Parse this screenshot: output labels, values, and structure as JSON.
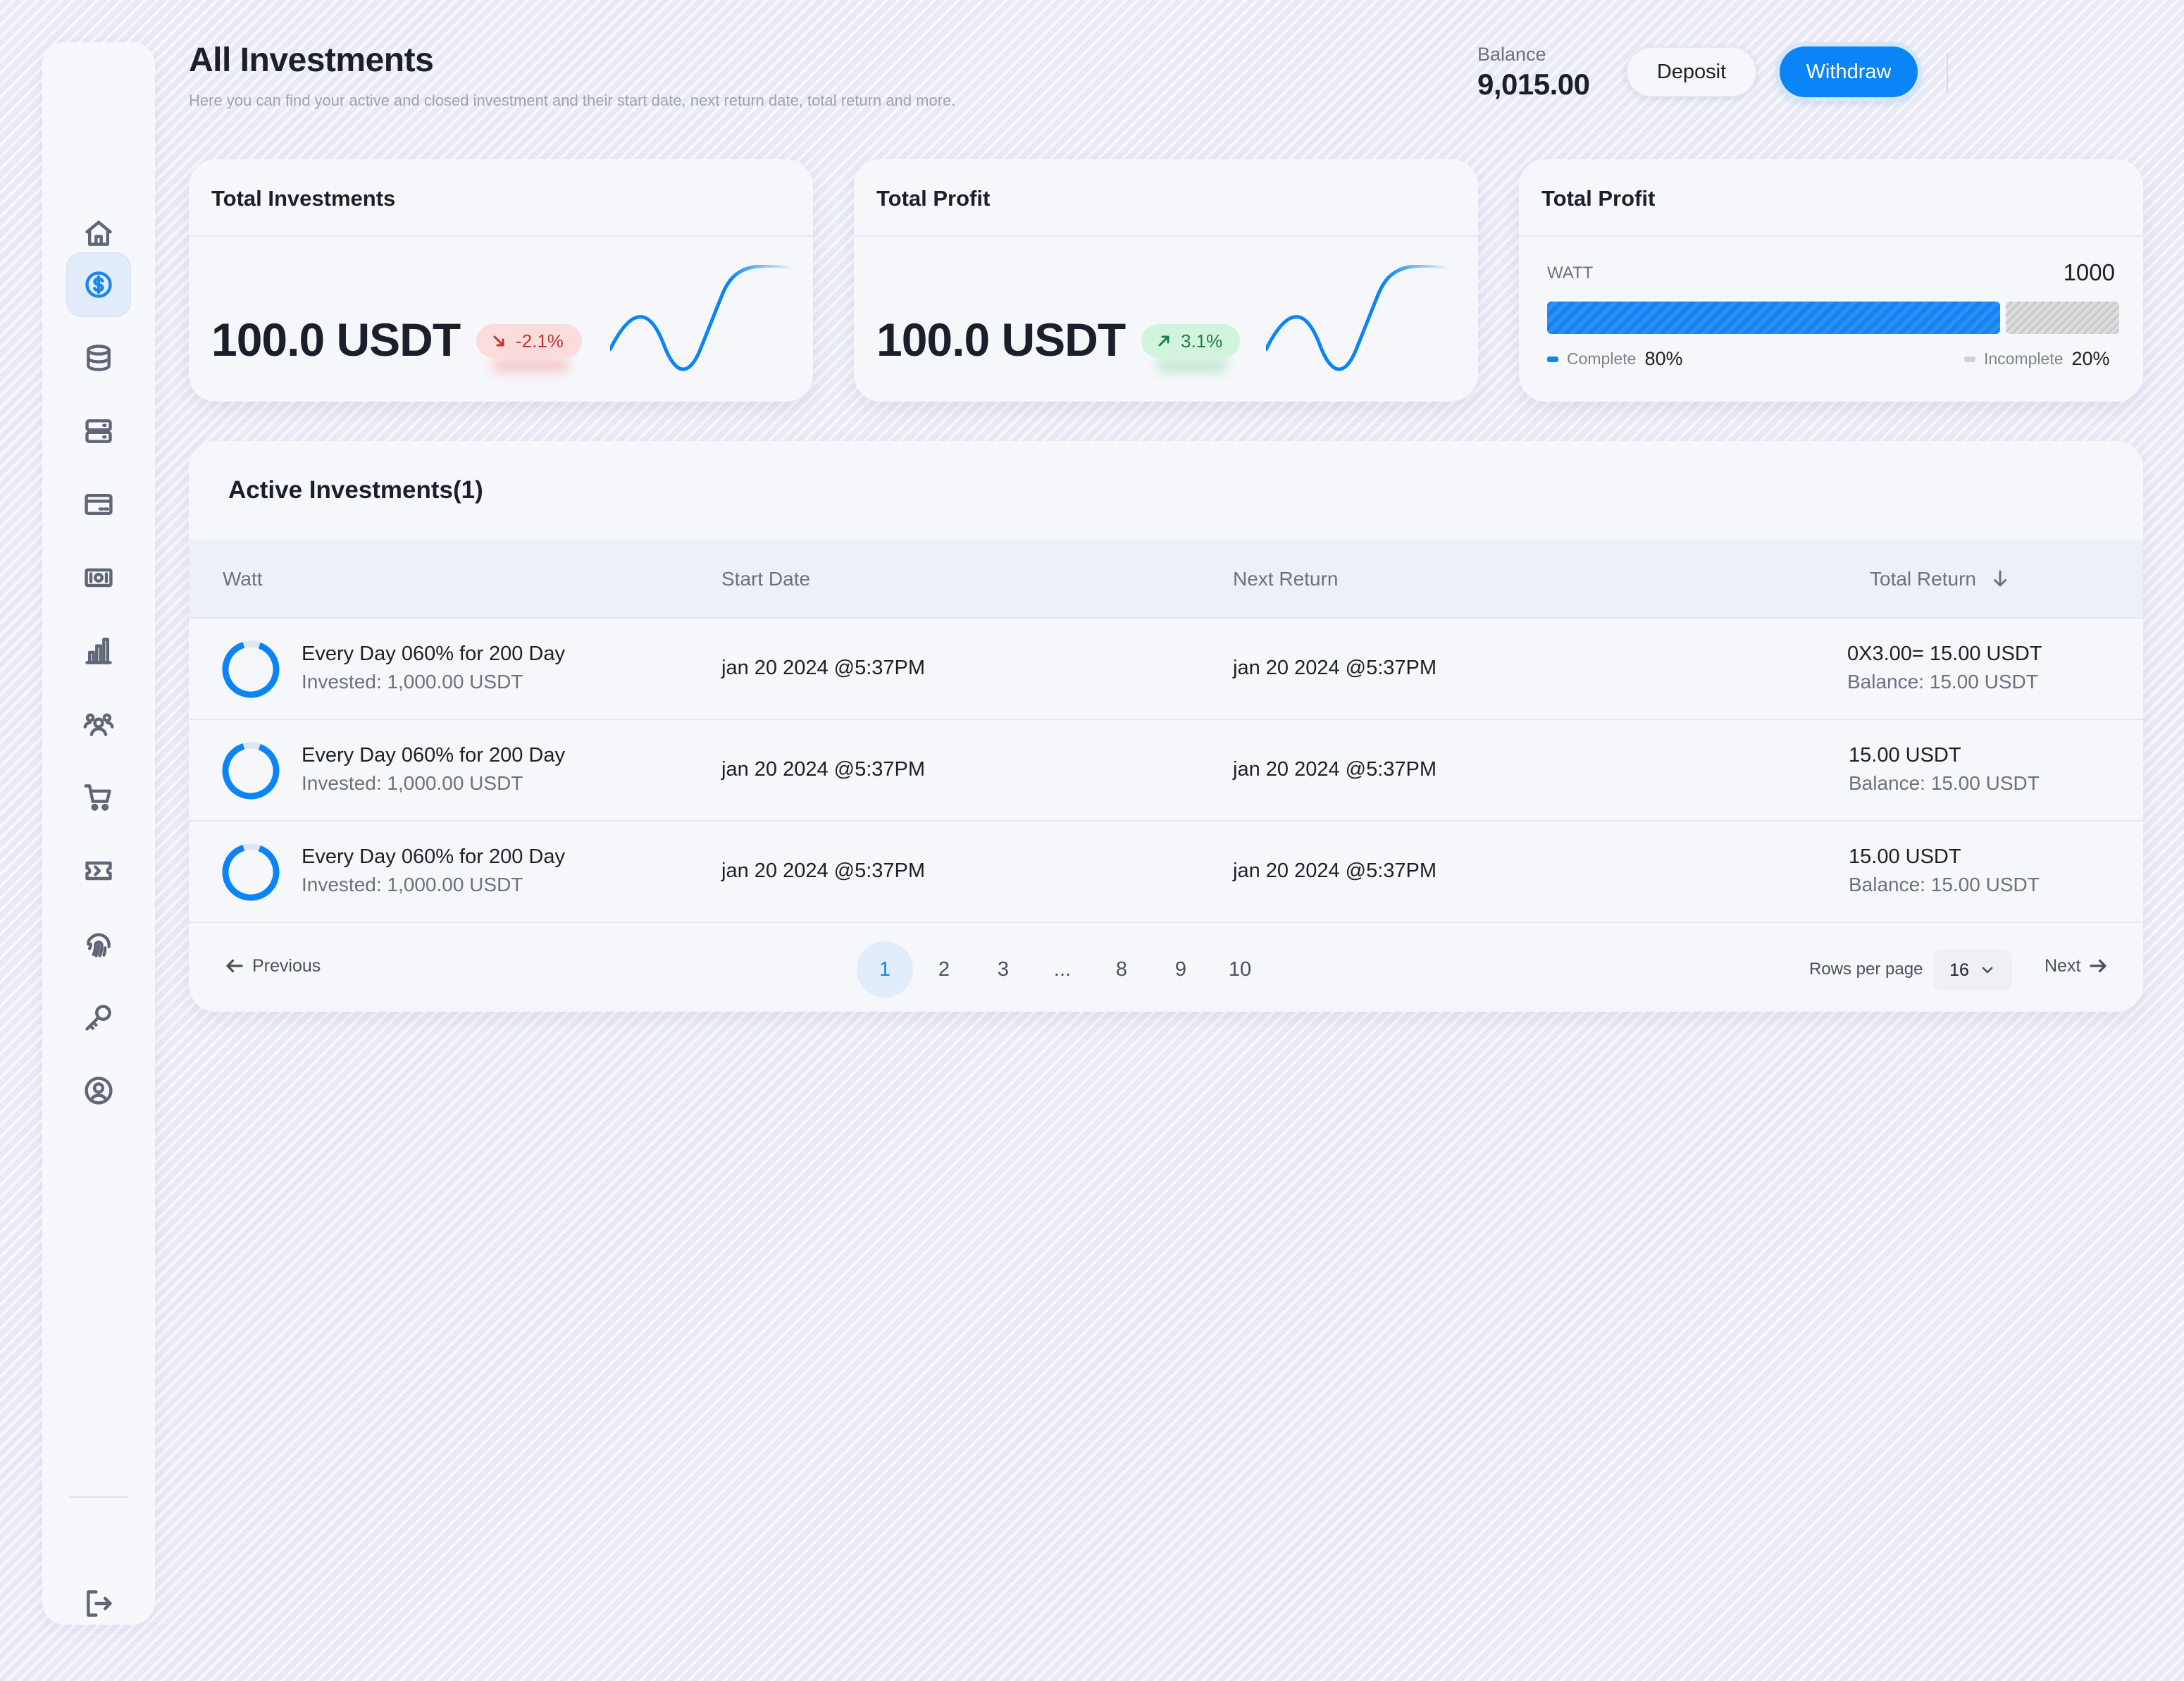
{
  "header": {
    "title": "All Investments",
    "subtitle": "Here you can find your active and closed investment and their start date, next return date, total return and more.",
    "balance_label": "Balance",
    "balance_value": "9,015.00",
    "deposit_label": "Deposit",
    "withdraw_label": "Withdraw"
  },
  "sidebar": {
    "items": [
      {
        "icon": "home-icon"
      },
      {
        "icon": "dollar-circle-icon",
        "active": true
      },
      {
        "icon": "database-icon"
      },
      {
        "icon": "server-icon"
      },
      {
        "icon": "card-icon"
      },
      {
        "icon": "money-icon"
      },
      {
        "icon": "bar-chart-icon"
      },
      {
        "icon": "users-icon"
      },
      {
        "icon": "cart-icon"
      },
      {
        "icon": "ticket-icon"
      },
      {
        "icon": "fingerprint-icon"
      },
      {
        "icon": "key-icon"
      },
      {
        "icon": "user-circle-icon"
      }
    ],
    "logout_icon": "logout-icon"
  },
  "cards": {
    "investments": {
      "title": "Total Investments",
      "value": "100.0 USDT",
      "change": "-2.1%",
      "trend": "down"
    },
    "profit": {
      "title": "Total Profit",
      "value": "100.0 USDT",
      "change": "3.1%",
      "trend": "up"
    },
    "progress": {
      "title": "Total Profit",
      "label": "WATT",
      "value": "1000",
      "complete_label": "Complete",
      "complete_pct": "80%",
      "incomplete_label": "Incomplete",
      "incomplete_pct": "20%",
      "complete_fraction": 0.8
    }
  },
  "table": {
    "title": "Active Investments(1)",
    "columns": [
      "Watt",
      "Start Date",
      "Next Return",
      "Total Return"
    ],
    "rows": [
      {
        "plan": "Every Day 060% for 200 Day",
        "invested": "Invested: 1,000.00 USDT",
        "start": "jan 20 2024 @5:37PM",
        "next": "jan 20 2024 @5:37PM",
        "total": "0X3.00= 15.00 USDT",
        "balance": "Balance: 15.00 USDT"
      },
      {
        "plan": "Every Day 060% for 200 Day",
        "invested": "Invested: 1,000.00 USDT",
        "start": "jan 20 2024 @5:37PM",
        "next": "jan 20 2024 @5:37PM",
        "total": "15.00 USDT",
        "balance": "Balance: 15.00 USDT"
      },
      {
        "plan": "Every Day 060% for 200 Day",
        "invested": "Invested: 1,000.00 USDT",
        "start": "jan 20 2024 @5:37PM",
        "next": "jan 20 2024 @5:37PM",
        "total": "15.00 USDT",
        "balance": "Balance: 15.00 USDT"
      }
    ]
  },
  "pagination": {
    "previous_label": "Previous",
    "next_label": "Next",
    "pages": [
      "1",
      "2",
      "3",
      "...",
      "8",
      "9",
      "10"
    ],
    "current_page": "1",
    "rows_per_page_label": "Rows per page",
    "rows_per_page_value": "16"
  },
  "colors": {
    "accent": "#0a84f6",
    "negative": "#c0352f",
    "positive": "#1a7f44"
  }
}
